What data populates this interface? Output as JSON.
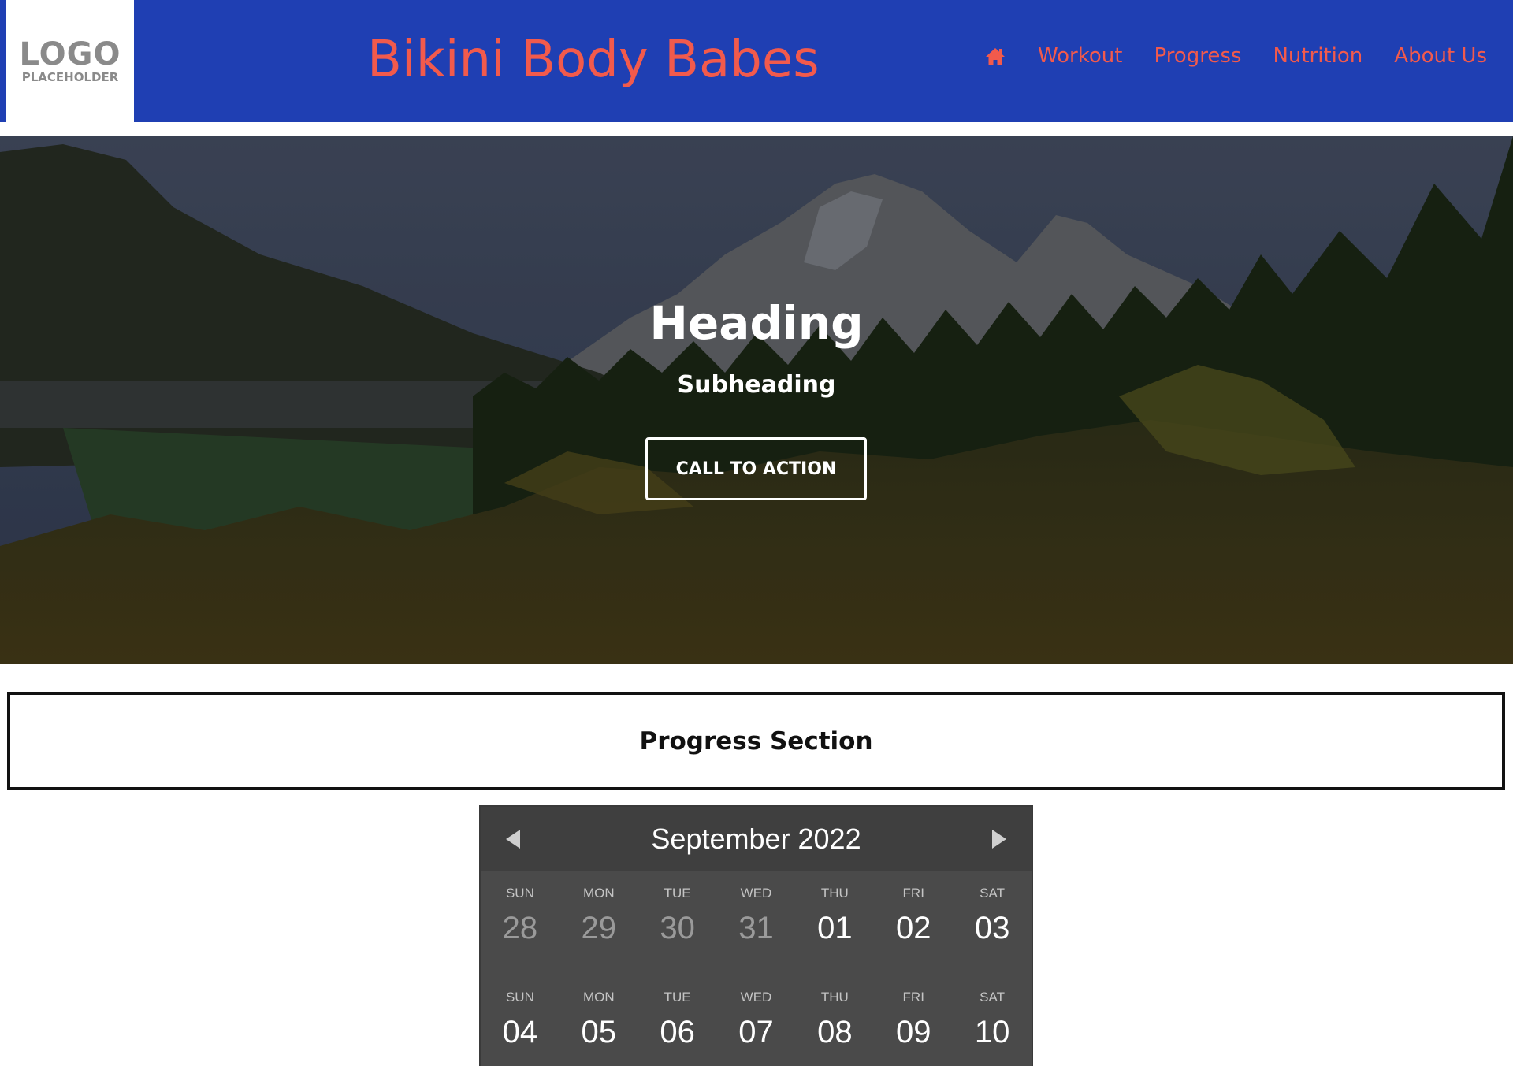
{
  "header": {
    "logo_main": "LOGO",
    "logo_sub": "PLACEHOLDER",
    "site_title": "Bikini Body Babes",
    "nav_items": [
      {
        "label": "Workout"
      },
      {
        "label": "Progress"
      },
      {
        "label": "Nutrition"
      },
      {
        "label": "About Us"
      }
    ],
    "home_icon": "home-icon"
  },
  "hero": {
    "heading": "Heading",
    "subheading": "Subheading",
    "cta_label": "CALL TO ACTION"
  },
  "progress": {
    "title": "Progress Section"
  },
  "calendar": {
    "month_label": "September 2022",
    "prev_icon": "triangle-left-icon",
    "next_icon": "triangle-right-icon",
    "weeks": [
      [
        {
          "dow": "SUN",
          "num": "28",
          "muted": true
        },
        {
          "dow": "MON",
          "num": "29",
          "muted": true
        },
        {
          "dow": "TUE",
          "num": "30",
          "muted": true
        },
        {
          "dow": "WED",
          "num": "31",
          "muted": true
        },
        {
          "dow": "THU",
          "num": "01",
          "muted": false
        },
        {
          "dow": "FRI",
          "num": "02",
          "muted": false
        },
        {
          "dow": "SAT",
          "num": "03",
          "muted": false
        }
      ],
      [
        {
          "dow": "SUN",
          "num": "04",
          "muted": false
        },
        {
          "dow": "MON",
          "num": "05",
          "muted": false
        },
        {
          "dow": "TUE",
          "num": "06",
          "muted": false
        },
        {
          "dow": "WED",
          "num": "07",
          "muted": false
        },
        {
          "dow": "THU",
          "num": "08",
          "muted": false
        },
        {
          "dow": "FRI",
          "num": "09",
          "muted": false
        },
        {
          "dow": "SAT",
          "num": "10",
          "muted": false
        }
      ]
    ]
  },
  "colors": {
    "header_bg": "#1f3fb3",
    "accent": "#f25a4c",
    "calendar_bg": "#4a4a4a",
    "calendar_header_bg": "#3f3f3f"
  }
}
